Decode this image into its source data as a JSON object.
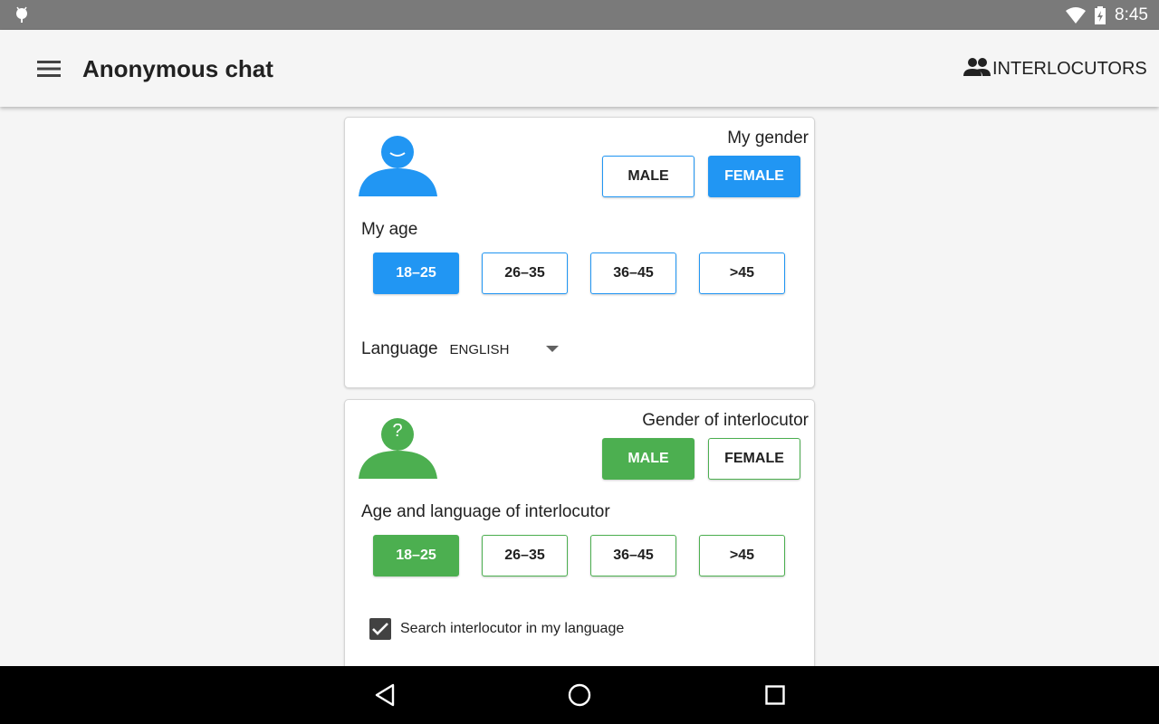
{
  "status_bar": {
    "time": "8:45"
  },
  "app_bar": {
    "title": "Anonymous chat",
    "action_label": "INTERLOCUTORS"
  },
  "my_profile": {
    "gender_label": "My gender",
    "gender_options": [
      "MALE",
      "FEMALE"
    ],
    "gender_selected": "FEMALE",
    "age_label": "My age",
    "age_options": [
      "18–25",
      "26–35",
      "36–45",
      ">45"
    ],
    "age_selected": "18–25",
    "language_label": "Language",
    "language_value": "ENGLISH"
  },
  "interlocutor": {
    "avatar_symbol": "?",
    "gender_label": "Gender of interlocutor",
    "gender_options": [
      "MALE",
      "FEMALE"
    ],
    "gender_selected": "MALE",
    "age_label": "Age and language of interlocutor",
    "age_options": [
      "18–25",
      "26–35",
      "36–45",
      ">45"
    ],
    "age_selected": "18–25",
    "same_language_label": "Search interlocutor in my language",
    "same_language_checked": true
  },
  "colors": {
    "my_accent": "#2196f3",
    "interlocutor_accent": "#4caf50",
    "status_bar": "#7a7a7a",
    "nav_bar": "#000000"
  },
  "icons": [
    "android-icon",
    "wifi-icon",
    "battery-icon",
    "menu-icon",
    "people-icon",
    "dropdown-arrow-icon",
    "check-icon",
    "back-icon",
    "home-icon",
    "recents-icon"
  ]
}
